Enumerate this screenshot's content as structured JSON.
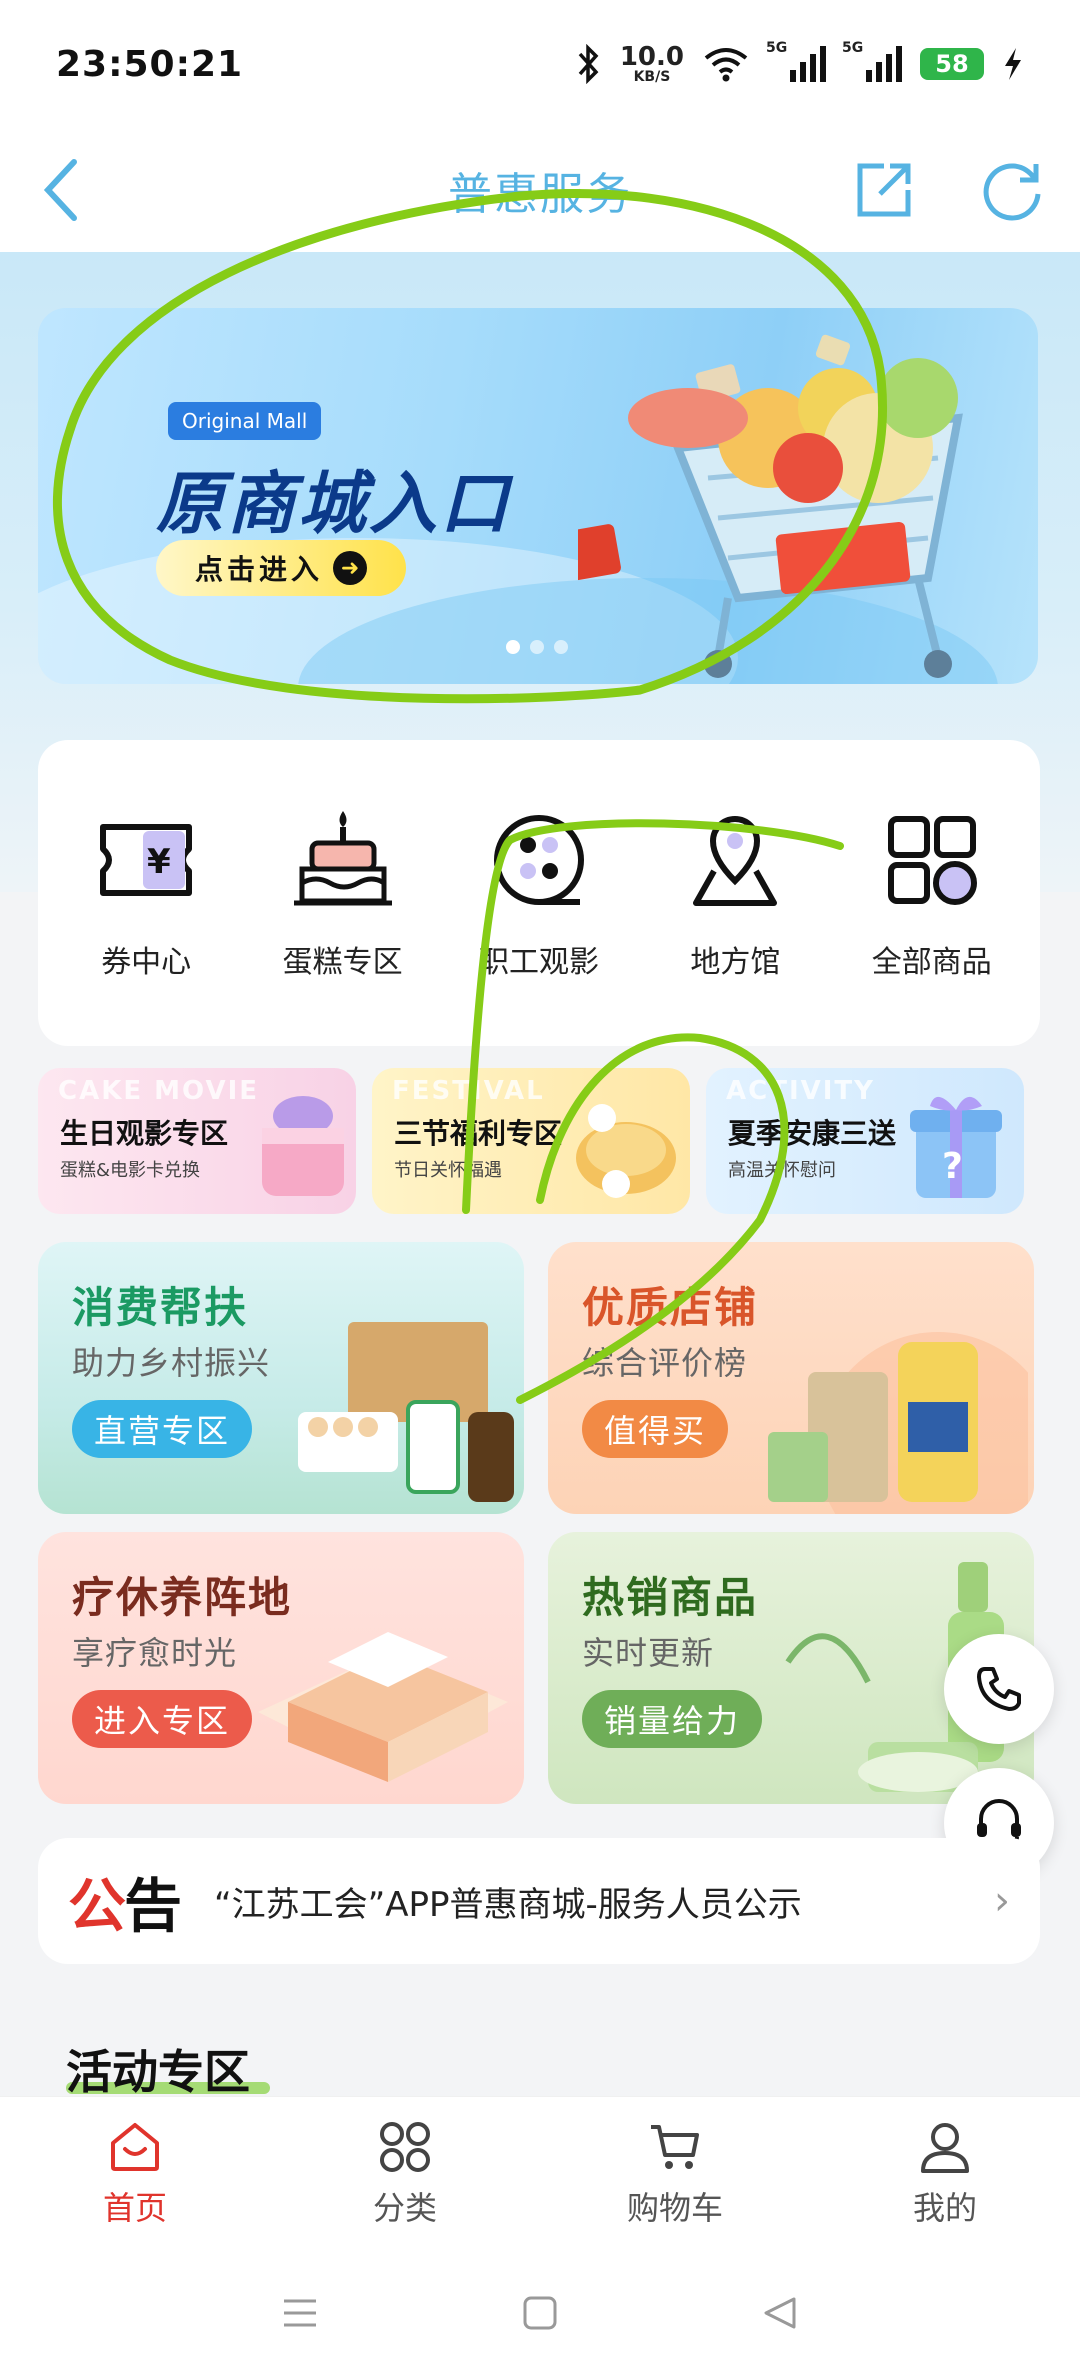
{
  "status_bar": {
    "time": "23:50:21",
    "net_speed_value": "10.0",
    "net_speed_unit": "KB/S",
    "signal1_tag": "5G",
    "signal2_tag": "5G",
    "battery": "58"
  },
  "header": {
    "title": "普惠服务",
    "back_icon": "chevron-left-icon",
    "share_icon": "share-icon",
    "refresh_icon": "refresh-icon"
  },
  "banner": {
    "tag": "Original Mall",
    "title": "原商城入口",
    "button_label": "点击进入",
    "active_slide": 1,
    "slide_count": 3
  },
  "categories": [
    {
      "label": "券中心",
      "icon": "coupon-icon"
    },
    {
      "label": "蛋糕专区",
      "icon": "cake-icon"
    },
    {
      "label": "职工观影",
      "icon": "movie-icon"
    },
    {
      "label": "地方馆",
      "icon": "location-icon"
    },
    {
      "label": "全部商品",
      "icon": "all-products-icon"
    }
  ],
  "promos": [
    {
      "ghost": "CAKE MOVIE",
      "title": "生日观影专区",
      "subtitle": "蛋糕&电影卡兑换"
    },
    {
      "ghost": "FESTIVAL",
      "title": "三节福利专区",
      "subtitle": "节日关怀福遇"
    },
    {
      "ghost": "ACTIVITY",
      "title": "夏季安康三送",
      "subtitle": "高温关怀慰问"
    }
  ],
  "tiles": [
    {
      "title": "消费帮扶",
      "subtitle": "助力乡村振兴",
      "button": "直营专区"
    },
    {
      "title": "优质店铺",
      "subtitle": "综合评价榜",
      "button": "值得买"
    },
    {
      "title": "疗休养阵地",
      "subtitle": "享疗愈时光",
      "button": "进入专区"
    },
    {
      "title": "热销商品",
      "subtitle": "实时更新",
      "button": "销量给力"
    }
  ],
  "notice": {
    "badge_red": "公",
    "badge_black": "告",
    "text": "“江苏工会”APP普惠商城-服务人员公示"
  },
  "section": {
    "title": "活动专区"
  },
  "bottom_nav": [
    {
      "label": "首页",
      "icon": "home-icon",
      "active": true
    },
    {
      "label": "分类",
      "icon": "category-icon",
      "active": false
    },
    {
      "label": "购物车",
      "icon": "cart-icon",
      "active": false
    },
    {
      "label": "我的",
      "icon": "user-icon",
      "active": false
    }
  ],
  "colors": {
    "accent": "#e0342c",
    "header_title": "#56b3e2",
    "annotation": "#86cc17"
  }
}
